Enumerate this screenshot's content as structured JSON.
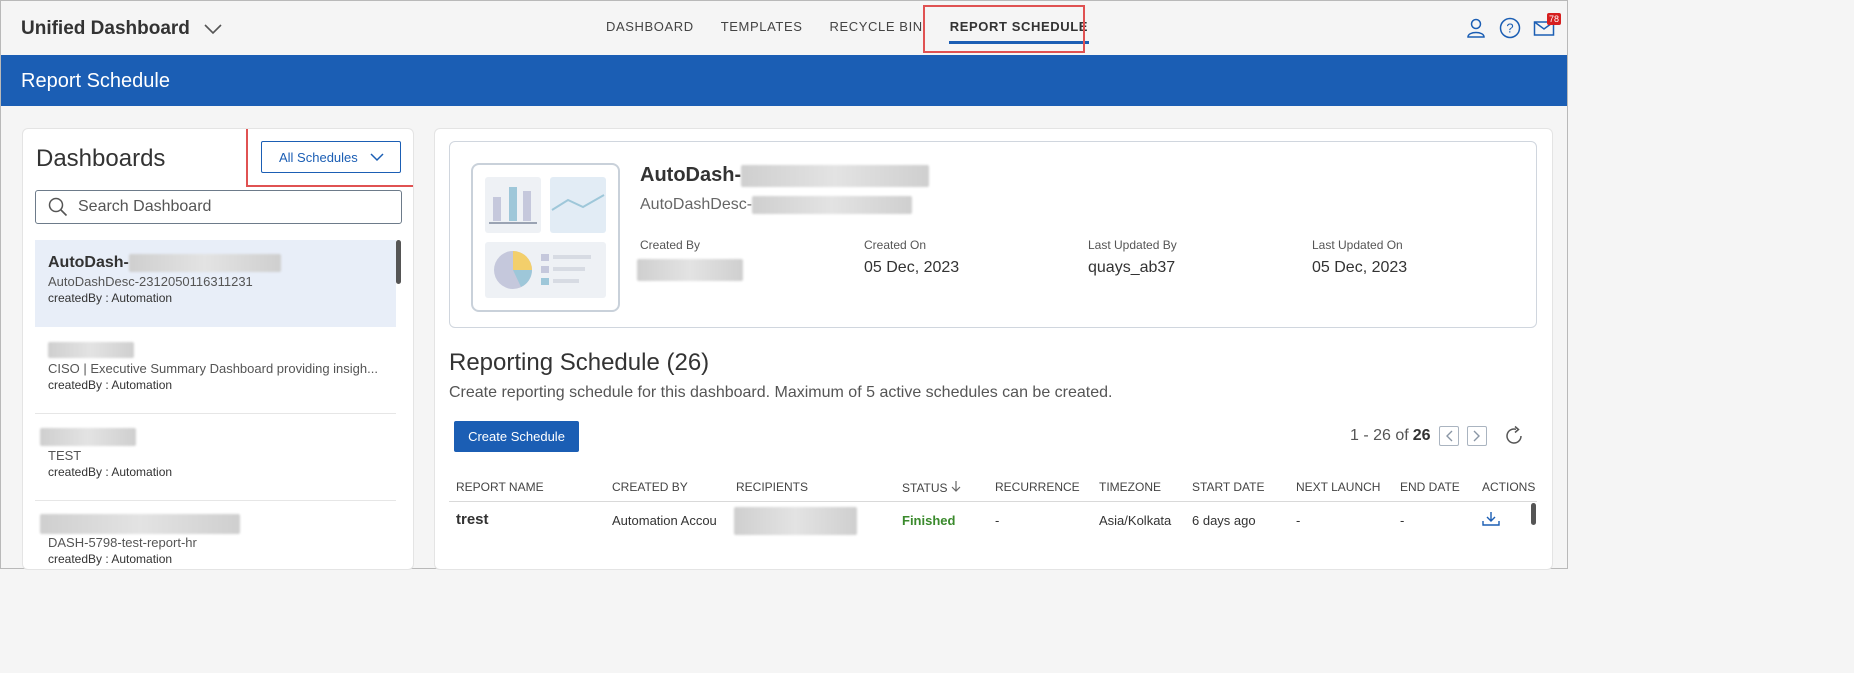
{
  "app": {
    "title": "Unified Dashboard",
    "nav_tabs": [
      "DASHBOARD",
      "TEMPLATES",
      "RECYCLE BIN",
      "REPORT SCHEDULE"
    ],
    "active_tab": "REPORT SCHEDULE",
    "notification_count": "78",
    "icons": [
      "user-icon",
      "help-icon",
      "mail-icon"
    ]
  },
  "banner": {
    "title": "Report Schedule"
  },
  "left": {
    "title": "Dashboards",
    "filter": "All Schedules",
    "search_placeholder": "Search Dashboard",
    "items": [
      {
        "name": "AutoDash-",
        "desc": "AutoDashDesc-2312050116311231",
        "created_by": "createdBy : Automation"
      },
      {
        "name": "",
        "desc": "CISO | Executive Summary Dashboard providing insigh...",
        "created_by": "createdBy : Automation"
      },
      {
        "name": "",
        "desc": "TEST",
        "created_by": "createdBy : Automation"
      },
      {
        "name": "",
        "desc": "DASH-5798-test-report-hr",
        "created_by": "createdBy : Automation"
      }
    ]
  },
  "detail": {
    "name": "AutoDash-",
    "desc": "AutoDashDesc-",
    "meta": [
      {
        "label": "Created By",
        "value": ""
      },
      {
        "label": "Created On",
        "value": "05 Dec, 2023"
      },
      {
        "label": "Last Updated By",
        "value": "quays_ab37"
      },
      {
        "label": "Last Updated On",
        "value": "05 Dec, 2023"
      }
    ]
  },
  "schedule": {
    "title": "Reporting Schedule (26)",
    "subtitle": "Create reporting schedule for this dashboard. Maximum of 5 active schedules can be created.",
    "create_label": "Create Schedule",
    "pager_range": "1 - 26 of",
    "pager_total": "26",
    "columns": [
      "REPORT NAME",
      "CREATED BY",
      "RECIPIENTS",
      "STATUS",
      "RECURRENCE",
      "TIMEZONE",
      "START DATE",
      "NEXT LAUNCH",
      "END DATE",
      "ACTIONS"
    ],
    "rows": [
      {
        "report_name": "trest",
        "created_by": "Automation Accou",
        "recipients": "",
        "status": "Finished",
        "recurrence": "-",
        "timezone": "Asia/Kolkata",
        "start_date": "6 days ago",
        "next_launch": "-",
        "end_date": "-"
      }
    ]
  },
  "colors": {
    "brand": "#1b5eb4",
    "highlight": "#e05252",
    "success": "#3a8a2c"
  }
}
